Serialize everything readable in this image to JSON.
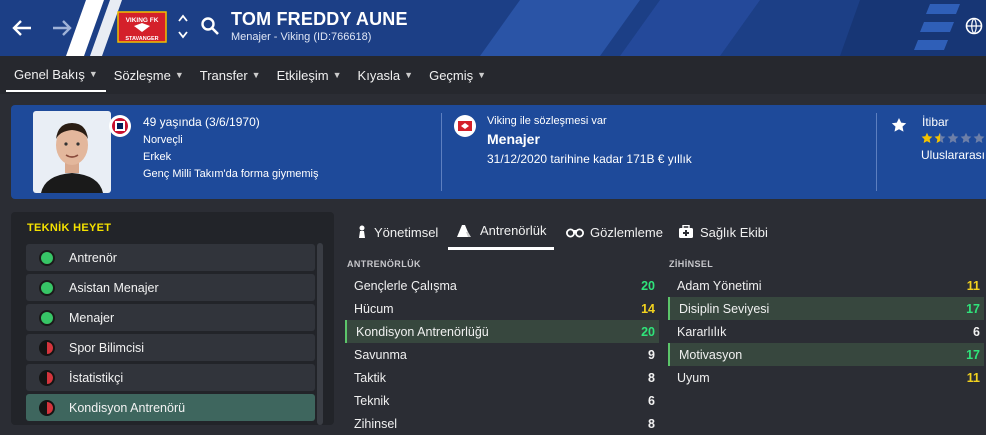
{
  "header": {
    "name": "TOM FREDDY AUNE",
    "subtitle": "Menajer - Viking (ID:766618)",
    "back_icon": "arrow-left-icon",
    "forward_icon": "arrow-right-icon",
    "crest_text_top": "VIKING FK",
    "crest_text_bottom": "STAVANGER"
  },
  "menu": [
    {
      "label": "Genel Bakış"
    },
    {
      "label": "Sözleşme"
    },
    {
      "label": "Transfer"
    },
    {
      "label": "Etkileşim"
    },
    {
      "label": "Kıyasla"
    },
    {
      "label": "Geçmiş"
    }
  ],
  "profile": {
    "age": "49 yaşında (3/6/1970)",
    "nationality": "Norveçli",
    "gender": "Erkek",
    "youth": "Genç Milli Takım'da forma giymemiş",
    "contract_label": "Viking ile sözleşmesi var",
    "role": "Menajer",
    "contract_detail": "31/12/2020 tarihine kadar 171B € yıllık",
    "reputation_label": "İtibar",
    "reputation_scope": "Uluslararası",
    "reputation_stars": 1.5,
    "colors": {
      "accent": "#1e4a9a",
      "header": "#1c3f86"
    }
  },
  "staff_panel": {
    "title": "TEKNİK HEYET",
    "items": [
      {
        "label": "Antrenör",
        "status": "green"
      },
      {
        "label": "Asistan Menajer",
        "status": "green"
      },
      {
        "label": "Menajer",
        "status": "green"
      },
      {
        "label": "Spor Bilimcisi",
        "status": "red"
      },
      {
        "label": "İstatistikçi",
        "status": "red"
      },
      {
        "label": "Kondisyon Antrenörü",
        "status": "red"
      }
    ]
  },
  "tabs": [
    {
      "label": "Yönetimsel",
      "icon": "chess-piece-icon"
    },
    {
      "label": "Antrenörlük",
      "icon": "cone-icon"
    },
    {
      "label": "Gözlemleme",
      "icon": "binoculars-icon"
    },
    {
      "label": "Sağlık Ekibi",
      "icon": "medical-kit-icon"
    }
  ],
  "coaching": {
    "title": "ANTRENÖRLÜK",
    "rows": [
      {
        "label": "Gençlerle Çalışma",
        "value": "20"
      },
      {
        "label": "Hücum",
        "value": "14"
      },
      {
        "label": "Kondisyon Antrenörlüğü",
        "value": "20"
      },
      {
        "label": "Savunma",
        "value": "9"
      },
      {
        "label": "Taktik",
        "value": "8"
      },
      {
        "label": "Teknik",
        "value": "6"
      },
      {
        "label": "Zihinsel",
        "value": "8"
      }
    ]
  },
  "mental": {
    "title": "ZİHİNSEL",
    "rows": [
      {
        "label": "Adam Yönetimi",
        "value": "11"
      },
      {
        "label": "Disiplin Seviyesi",
        "value": "17"
      },
      {
        "label": "Kararlılık",
        "value": "6"
      },
      {
        "label": "Motivasyon",
        "value": "17"
      },
      {
        "label": "Uyum",
        "value": "11"
      }
    ]
  }
}
